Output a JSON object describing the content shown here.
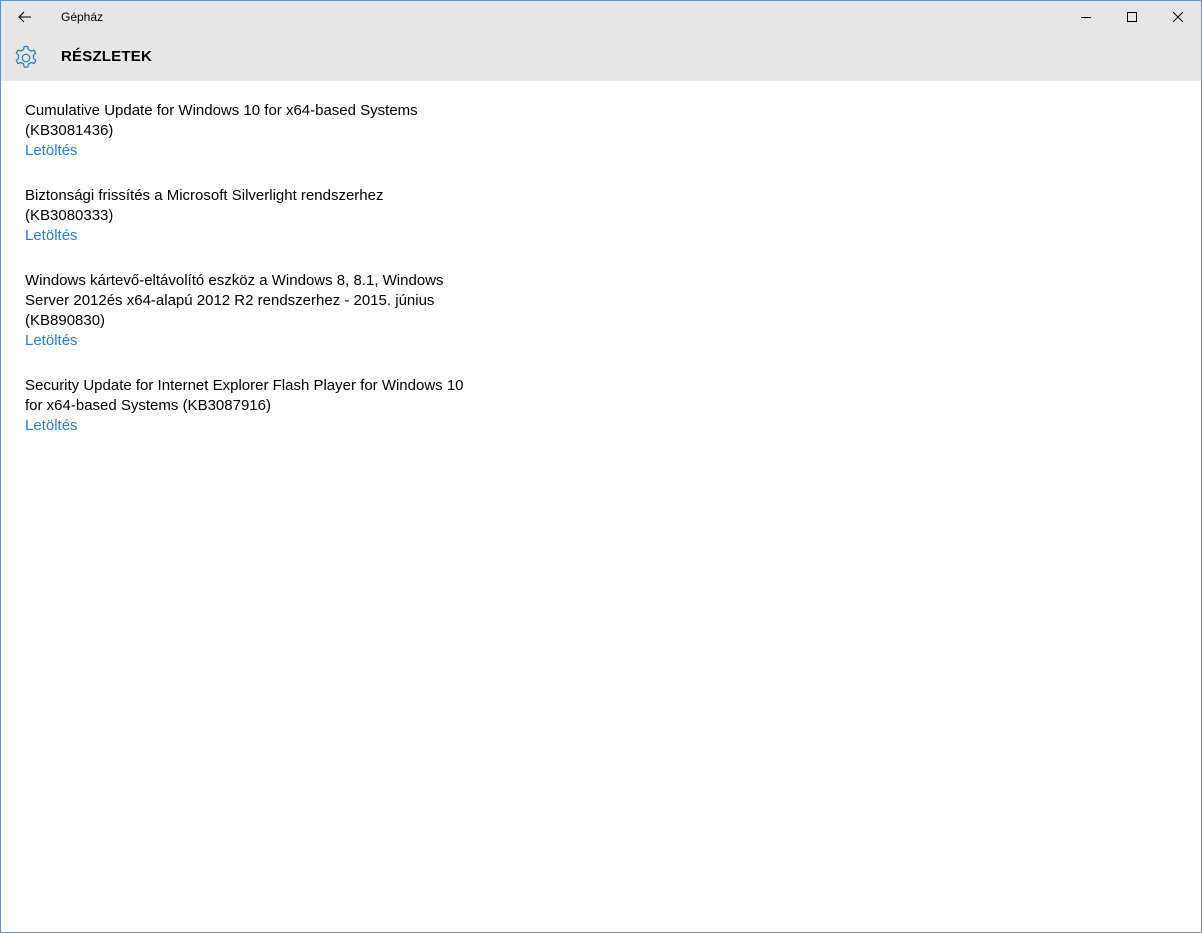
{
  "window": {
    "title": "Gépház"
  },
  "header": {
    "title": "RÉSZLETEK"
  },
  "colors": {
    "accent": "#2b7dc5",
    "chrome": "#e6e6e6"
  },
  "updates": [
    {
      "title": "Cumulative Update for Windows 10 for x64-based Systems (KB3081436)",
      "link": "Letöltés"
    },
    {
      "title": "Biztonsági frissítés a Microsoft Silverlight rendszerhez (KB3080333)",
      "link": "Letöltés"
    },
    {
      "title": "Windows kártevő-eltávolító eszköz a Windows 8, 8.1, Windows Server 2012és x64-alapú 2012 R2 rendszerhez - 2015. június (KB890830)",
      "link": "Letöltés"
    },
    {
      "title": "Security Update for Internet Explorer Flash Player for Windows 10 for x64-based Systems (KB3087916)",
      "link": "Letöltés"
    }
  ]
}
